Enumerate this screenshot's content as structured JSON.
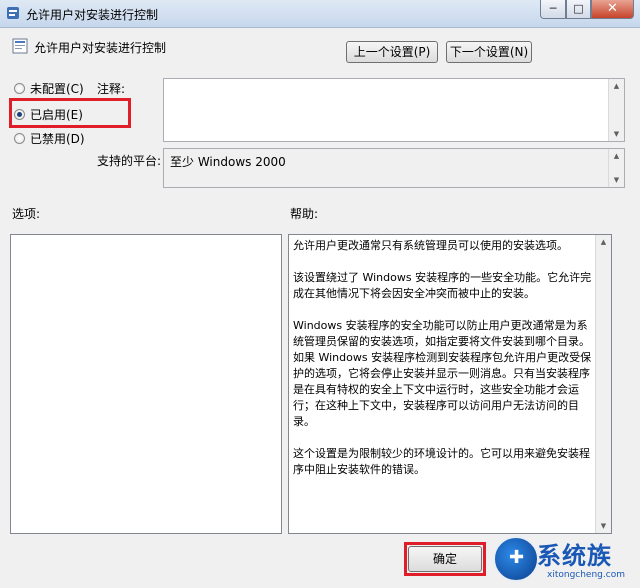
{
  "window": {
    "title": "允许用户对安装进行控制",
    "min_glyph": "─",
    "max_glyph": "□",
    "close_glyph": "✕"
  },
  "policy": {
    "name": "允许用户对安装进行控制"
  },
  "nav": {
    "prev_label": "上一个设置(P)",
    "next_label": "下一个设置(N)"
  },
  "state": {
    "options": [
      {
        "label": "未配置(C)",
        "checked": false
      },
      {
        "label": "已启用(E)",
        "checked": true
      },
      {
        "label": "已禁用(D)",
        "checked": false
      }
    ]
  },
  "labels": {
    "comment": "注释:",
    "platform": "支持的平台:",
    "options": "选项:",
    "help": "帮助:"
  },
  "platform": {
    "value": "至少 Windows 2000"
  },
  "help": {
    "paragraphs": [
      "允许用户更改通常只有系统管理员可以使用的安装选项。",
      "该设置绕过了 Windows 安装程序的一些安全功能。它允许完成在其他情况下将会因安全冲突而被中止的安装。",
      "Windows 安装程序的安全功能可以防止用户更改通常是为系统管理员保留的安装选项，如指定要将文件安装到哪个目录。如果 Windows 安装程序检测到安装程序包允许用户更改受保护的选项，它将会停止安装并显示一则消息。只有当安装程序是在具有特权的安全上下文中运行时，这些安全功能才会运行；在这种上下文中，安装程序可以访问用户无法访问的目录。",
      "这个设置是为限制较少的环境设计的。它可以用来避免安装程序中阻止安装软件的错误。"
    ]
  },
  "footer": {
    "ok_label": "确定"
  },
  "watermark": {
    "brand": "系统族",
    "url": "xitongcheng.com"
  },
  "colors": {
    "highlight": "#e01e2a",
    "watermark": "#1a58b6"
  }
}
